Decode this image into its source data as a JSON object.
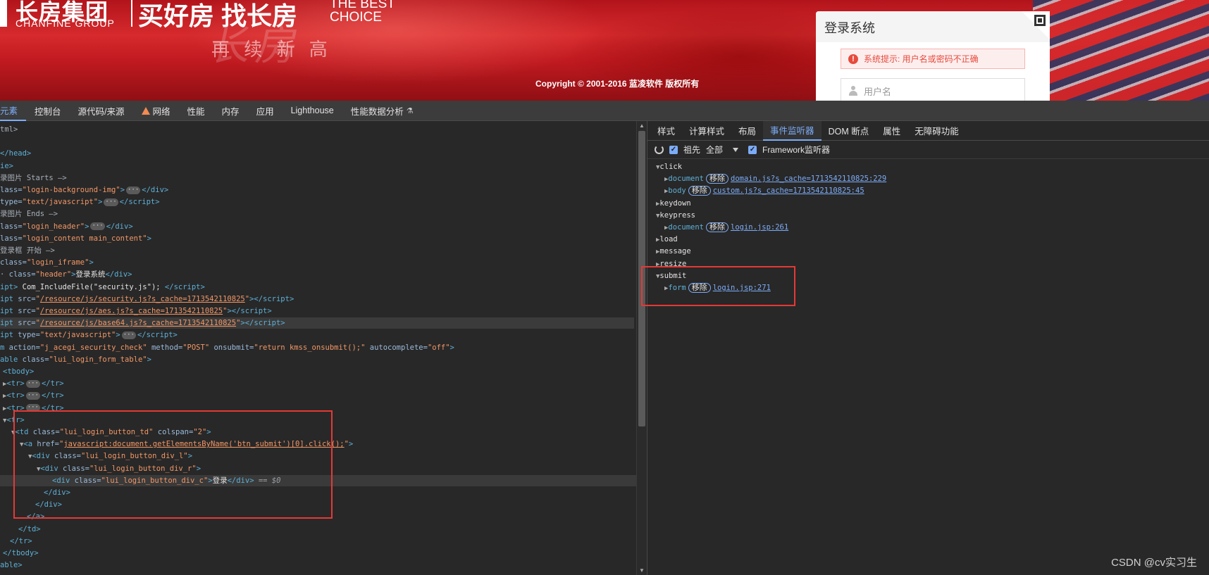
{
  "page": {
    "logo_cn": "长房集团",
    "logo_en": "CHANFINE GROUP",
    "slogan_cn": "买好房 找长房",
    "slogan_en": "THE BEST CHOICE",
    "copyright": "Copyright © 2001-2016 蓝凌软件 版权所有",
    "login": {
      "title": "登录系统",
      "error": "系统提示:  用户名或密码不正确",
      "username_placeholder": "用户名"
    }
  },
  "devtools": {
    "tabs": [
      "元素",
      "控制台",
      "源代码/来源",
      "网络",
      "性能",
      "内存",
      "应用",
      "Lighthouse",
      "性能数据分析"
    ],
    "side_tabs": [
      "样式",
      "计算样式",
      "布局",
      "事件监听器",
      "DOM 断点",
      "属性",
      "无障碍功能"
    ],
    "toolbar": {
      "ancestors": "祖先",
      "all": "全部",
      "framework": "Framework监听器"
    },
    "dom_lines": [
      {
        "html": "<span class='cm'>tml&gt;</span>"
      },
      {
        "html": ""
      },
      {
        "html": "<span class='t'>&lt;/head&gt;</span>"
      },
      {
        "html": "<span class='t'>ie&gt;</span>"
      },
      {
        "html": "<span class='cm'>录图片 Starts —&gt;</span>"
      },
      {
        "html": "<span class='an'>lass=</span><span class='av'>\"login-background-img\"</span><span class='t'>&gt;</span><span class='dots'>···</span><span class='t'>&lt;/div&gt;</span>"
      },
      {
        "html": "<span class='an'> type=</span><span class='av'>\"text/javascript\"</span><span class='t'>&gt;</span><span class='dots'>···</span><span class='t'>&lt;/script&gt;</span>"
      },
      {
        "html": "<span class='cm'>录图片 Ends —&gt;</span>"
      },
      {
        "html": "<span class='an'>lass=</span><span class='av'>\"login_header\"</span><span class='t'>&gt;</span><span class='dots'>···</span><span class='t'>&lt;/div&gt;</span>"
      },
      {
        "html": "<span class='an'>lass=</span><span class='av'>\"login_content main_content\"</span><span class='t'>&gt;</span>"
      },
      {
        "html": "<span class='cm'>登录框 开始 —&gt;</span>"
      },
      {
        "html": "<span class='an'>class=</span><span class='av'>\"login_iframe\"</span><span class='t'>&gt;</span>"
      },
      {
        "html": "<span class='an'>· class=</span><span class='av'>\"header\"</span><span class='t'>&gt;</span><span class='tx'>登录系统</span><span class='t'>&lt;/div&gt;</span>"
      },
      {
        "html": "<span class='t'>ipt&gt;</span><span class='tx'> Com_IncludeFile(\"security.js\"); </span><span class='t'>&lt;/script&gt;</span>"
      },
      {
        "html": "<span class='t'>ipt </span><span class='an'>src=</span><span class='av'>\"</span><span class='link'>/resource/js/security.js?s_cache=1713542110825</span><span class='av'>\"</span><span class='t'>&gt;&lt;/script&gt;</span>"
      },
      {
        "html": "<span class='t'>ipt </span><span class='an'>src=</span><span class='av'>\"</span><span class='link'>/resource/js/aes.js?s_cache=1713542110825</span><span class='av'>\"</span><span class='t'>&gt;&lt;/script&gt;</span>"
      },
      {
        "html": "<span class='t'>ipt </span><span class='an'>src=</span><span class='av'>\"</span><span class='link'>/resource/js/base64.js?s_cache=1713542110825</span><span class='av'>\"</span><span class='t'>&gt;&lt;/script&gt;</span>",
        "hover": true
      },
      {
        "html": "<span class='t'>ipt </span><span class='an'>type=</span><span class='av'>\"text/javascript\"</span><span class='t'>&gt;</span><span class='dots'>···</span><span class='t'>&lt;/script&gt;</span>"
      },
      {
        "html": "<span class='t'>m </span><span class='an'>action=</span><span class='av'>\"j_acegi_security_check\"</span><span class='an'> method=</span><span class='av'>\"POST\"</span><span class='an'> onsubmit=</span><span class='av'>\"return kmss_onsubmit();\"</span><span class='an'> autocomplete=</span><span class='av'>\"off\"</span><span class='t'>&gt;</span>"
      },
      {
        "html": "<span class='t'>able </span><span class='an'>class=</span><span class='av'>\"lui_login_form_table\"</span><span class='t'>&gt;</span>"
      },
      {
        "html": "<span class='t'>&lt;tbody&gt;</span>",
        "indent": 4
      },
      {
        "html": "<span class='arrow'>▶</span><span class='t'>&lt;tr&gt;</span><span class='dots'>···</span><span class='t'>&lt;/tr&gt;</span>",
        "indent": 4
      },
      {
        "html": "<span class='arrow'>▶</span><span class='t'>&lt;tr&gt;</span><span class='dots'>···</span><span class='t'>&lt;/tr&gt;</span>",
        "indent": 4
      },
      {
        "html": "<span class='arrow'>▶</span><span class='t'>&lt;tr&gt;</span><span class='dots'>···</span><span class='t'>&lt;/tr&gt;</span>",
        "indent": 4
      },
      {
        "html": "<span class='arrow'>▼</span><span class='t'>&lt;tr&gt;</span>",
        "indent": 4
      },
      {
        "html": "<span class='arrow'>▼</span><span class='t'>&lt;td </span><span class='an'>class=</span><span class='av'>\"lui_login_button_td\"</span><span class='an'> colspan=</span><span class='av'>\"2\"</span><span class='t'>&gt;</span>",
        "indent": 16
      },
      {
        "html": "<span class='arrow'>▼</span><span class='t'>&lt;a </span><span class='an'>href=</span><span class='av'>\"</span><span class='link'>javascript:document.getElementsByName('btn_submit')[0].click();</span><span class='av'>\"</span><span class='t'>&gt;</span>",
        "indent": 28
      },
      {
        "html": "<span class='arrow'>▼</span><span class='t'>&lt;div </span><span class='an'>class=</span><span class='av'>\"lui_login_button_div_l\"</span><span class='t'>&gt;</span>",
        "indent": 40
      },
      {
        "html": "<span class='arrow'>▼</span><span class='t'>&lt;div </span><span class='an'>class=</span><span class='av'>\"lui_login_button_div_r\"</span><span class='t'>&gt;</span>",
        "indent": 52
      },
      {
        "html": "<span class='t'>&lt;div </span><span class='an'>class=</span><span class='av'>\"lui_login_button_div_c\"</span><span class='t'>&gt;</span><span class='tx'>登录</span><span class='t'>&lt;/div&gt;</span><span class='eq0'> == $0</span>",
        "indent": 74,
        "selected": true
      },
      {
        "html": "<span class='t'>&lt;/div&gt;</span>",
        "indent": 62
      },
      {
        "html": "<span class='t'>&lt;/div&gt;</span>",
        "indent": 50
      },
      {
        "html": "<span class='t'>&lt;/a&gt;</span>",
        "indent": 38
      },
      {
        "html": "<span class='t'>&lt;/td&gt;</span>",
        "indent": 26
      },
      {
        "html": "<span class='t'>&lt;/tr&gt;</span>",
        "indent": 14
      },
      {
        "html": "<span class='t'>&lt;/tbody&gt;</span>",
        "indent": 4
      },
      {
        "html": "<span class='t'>able&gt;</span>"
      }
    ],
    "events": [
      {
        "kind": "group",
        "label": "click",
        "open": true
      },
      {
        "kind": "item",
        "node": "document",
        "remove": "移除",
        "link": "domain.js?s_cache=1713542110825:229"
      },
      {
        "kind": "item",
        "node": "body",
        "remove": "移除",
        "link": "custom.js?s_cache=1713542110825:45"
      },
      {
        "kind": "group",
        "label": "keydown",
        "open": false
      },
      {
        "kind": "group",
        "label": "keypress",
        "open": true
      },
      {
        "kind": "item",
        "node": "document",
        "remove": "移除",
        "link": "login.jsp:261"
      },
      {
        "kind": "group",
        "label": "load",
        "open": false
      },
      {
        "kind": "group",
        "label": "message",
        "open": false
      },
      {
        "kind": "group",
        "label": "resize",
        "open": false
      },
      {
        "kind": "group",
        "label": "submit",
        "open": true
      },
      {
        "kind": "item",
        "node": "form",
        "remove": "移除",
        "link": "login.jsp:271"
      }
    ]
  },
  "watermark": "CSDN @cv实习生"
}
